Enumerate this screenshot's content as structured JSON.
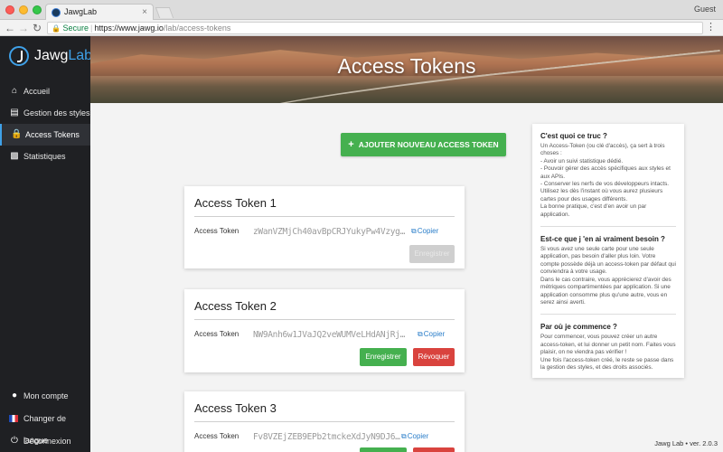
{
  "browser": {
    "tab_title": "JawgLab",
    "tab_close": "×",
    "guest": "Guest",
    "secure_label": "Secure",
    "url_host": "https://www.jawg.io",
    "url_path": "/lab/access-tokens"
  },
  "sidebar": {
    "logo_jawg": "Jawg",
    "logo_lab": "Lab",
    "items": [
      {
        "label": "Accueil",
        "icon": "home-icon"
      },
      {
        "label": "Gestion des styles",
        "icon": "map-icon"
      },
      {
        "label": "Access Tokens",
        "icon": "lock-icon",
        "active": true
      },
      {
        "label": "Statistiques",
        "icon": "bar-chart-icon"
      }
    ],
    "bottom_items": [
      {
        "label": "Mon compte",
        "icon": "user-icon"
      },
      {
        "label": "Changer de langue",
        "icon": "french-flag-icon"
      },
      {
        "label": "Déconnexion",
        "icon": "power-icon"
      }
    ]
  },
  "hero": {
    "title": "Access Tokens"
  },
  "main": {
    "add_button": "AJOUTER NOUVEAU ACCESS TOKEN",
    "tokens": [
      {
        "title": "Access Token 1",
        "label": "Access Token",
        "value": "zWanVZMjCh40avBpCRJYukyPw4Vzyg…",
        "copy": "Copier",
        "save": "Enregistrer",
        "save_disabled": true
      },
      {
        "title": "Access Token 2",
        "label": "Access Token",
        "value": "NW9Anh6w1JVaJQ2veWUMVeLHdANjRj…",
        "copy": "Copier",
        "save": "Enregistrer",
        "revoke": "Révoquer"
      },
      {
        "title": "Access Token 3",
        "label": "Access Token",
        "value": "Fv8VZEjZEB9EPb2tmckeXdJyN9DJ6j…",
        "copy": "Copier"
      }
    ]
  },
  "info": {
    "s1_title": "C'est quoi ce truc ?",
    "s1_text": "Un Access-Token (ou clé d'accès), ça sert à trois choses :\n- Avoir un suivi statistique dédié.\n- Pouvoir gérer des accès spécifiques aux styles et aux APIs.\n- Conserver les nerfs de vos développeurs intacts.\nUtilisez les dès l'instant où vous aurez plusieurs cartes pour des usages différents.\nLa bonne pratique, c'est d'en avoir un par application.",
    "s2_title": "Est-ce que j 'en ai vraiment besoin ?",
    "s2_text": "Si vous avez une seule carte pour une seule application, pas besoin d'aller plus loin. Votre compte possède déjà un access-token par défaut qui conviendra à votre usage.\nDans le cas contraire, vous apprécierez d'avoir des métriques compartimentées par application. Si une application consomme plus qu'une autre, vous en serez ainsi averti.",
    "s3_title": "Par où je commence ?",
    "s3_text": "Pour commencer, vous pouvez créer un autre access-token, et lui donner un petit nom. Faites vous plaisir, on ne viendra pas vérifier !\nUne fois l'access-token créé, le reste se passe dans la gestion des styles, et des droits associés."
  },
  "footer": {
    "version": "Jawg Lab • ver. 2.0.3"
  }
}
